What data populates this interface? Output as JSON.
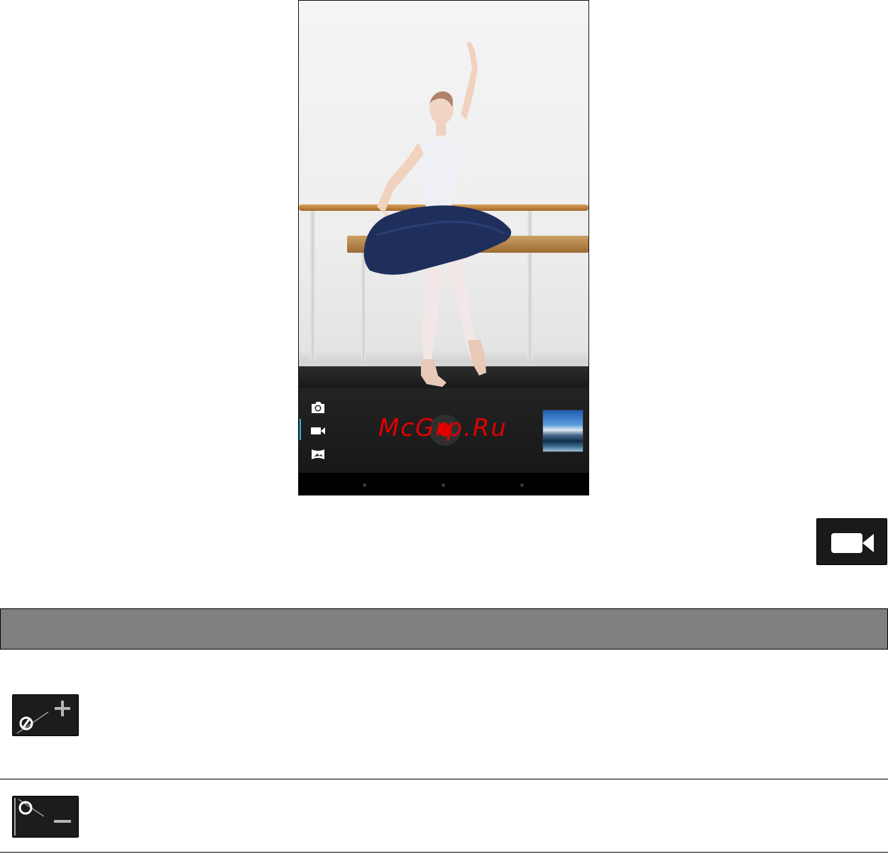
{
  "camera": {
    "modes": [
      {
        "icon": "camera-icon",
        "active": false
      },
      {
        "icon": "video-camera-icon",
        "active": true
      },
      {
        "icon": "panorama-icon",
        "active": false
      }
    ],
    "accent_color": "#33b5e5",
    "shutter_color": "#e00000",
    "watermark": "McGrp.Ru"
  },
  "icons": {
    "video_mode": "video-camera-icon",
    "zoom_in": "zoom-in-icon",
    "zoom_out": "zoom-out-icon"
  },
  "header_bar": {
    "color": "#808080"
  }
}
